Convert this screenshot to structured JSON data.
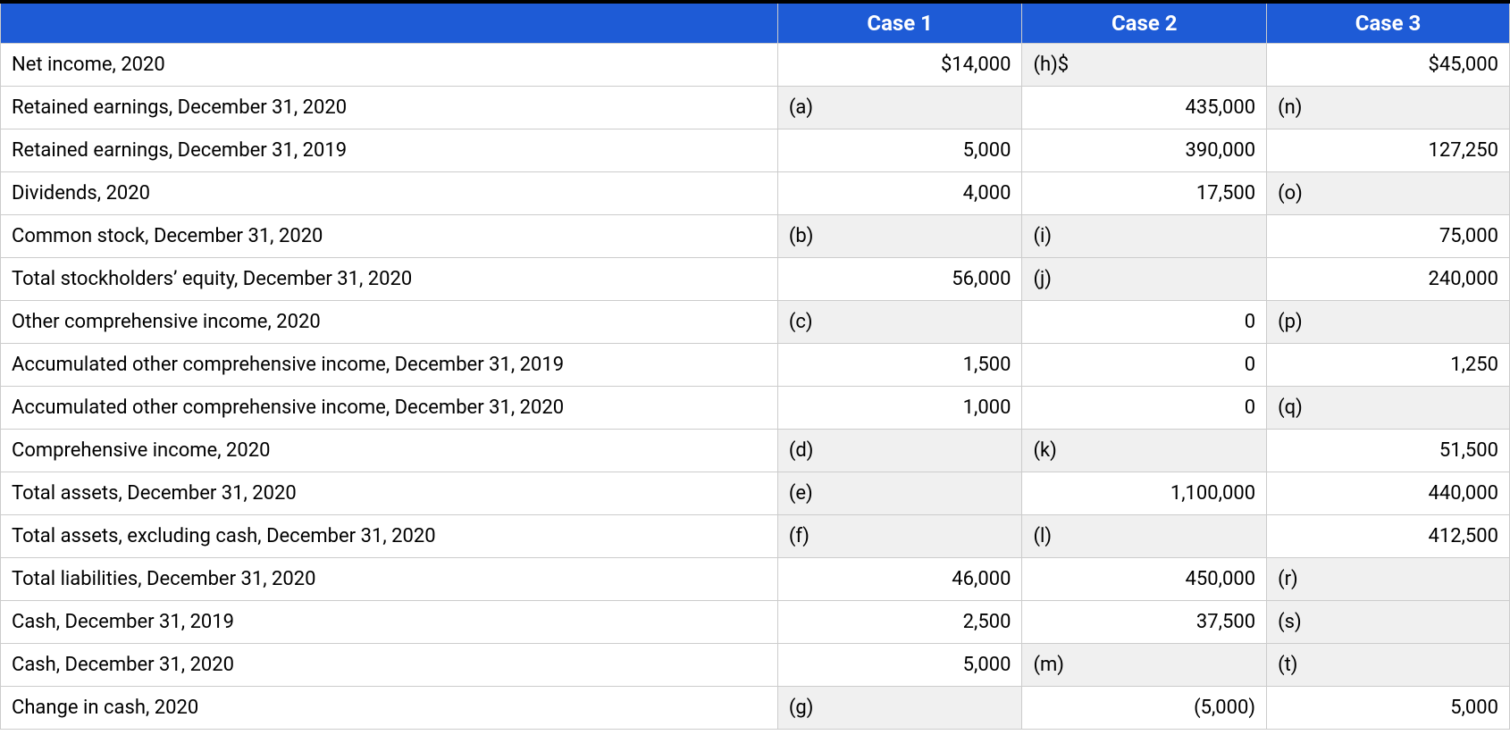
{
  "chart_data": {
    "type": "table",
    "headers": [
      "",
      "Case 1",
      "Case 2",
      "Case 3"
    ],
    "rows": [
      {
        "label": "Net income, 2020",
        "c1": {
          "v": "$14,000",
          "t": "num"
        },
        "c2": {
          "v": "(h)$",
          "t": "letter"
        },
        "c3": {
          "v": "$45,000",
          "t": "num"
        }
      },
      {
        "label": "Retained earnings, December 31, 2020",
        "c1": {
          "v": "(a)",
          "t": "letter"
        },
        "c2": {
          "v": "435,000",
          "t": "num"
        },
        "c3": {
          "v": "(n)",
          "t": "letter"
        }
      },
      {
        "label": "Retained earnings, December 31, 2019",
        "c1": {
          "v": "5,000",
          "t": "num"
        },
        "c2": {
          "v": "390,000",
          "t": "num"
        },
        "c3": {
          "v": "127,250",
          "t": "num"
        }
      },
      {
        "label": "Dividends, 2020",
        "c1": {
          "v": "4,000",
          "t": "num"
        },
        "c2": {
          "v": "17,500",
          "t": "num"
        },
        "c3": {
          "v": "(o)",
          "t": "letter"
        }
      },
      {
        "label": "Common stock, December 31, 2020",
        "c1": {
          "v": "(b)",
          "t": "letter"
        },
        "c2": {
          "v": "(i)",
          "t": "letter"
        },
        "c3": {
          "v": "75,000",
          "t": "num"
        }
      },
      {
        "label": "Total stockholders’ equity, December 31, 2020",
        "c1": {
          "v": "56,000",
          "t": "num"
        },
        "c2": {
          "v": "(j)",
          "t": "letter"
        },
        "c3": {
          "v": "240,000",
          "t": "num"
        }
      },
      {
        "label": "Other comprehensive income, 2020",
        "c1": {
          "v": "(c)",
          "t": "letter"
        },
        "c2": {
          "v": "0",
          "t": "num"
        },
        "c3": {
          "v": "(p)",
          "t": "letter"
        }
      },
      {
        "label": "Accumulated other comprehensive income, December 31, 2019",
        "c1": {
          "v": "1,500",
          "t": "num"
        },
        "c2": {
          "v": "0",
          "t": "num"
        },
        "c3": {
          "v": "1,250",
          "t": "num"
        }
      },
      {
        "label": "Accumulated other comprehensive income, December 31, 2020",
        "c1": {
          "v": "1,000",
          "t": "num"
        },
        "c2": {
          "v": "0",
          "t": "num"
        },
        "c3": {
          "v": "(q)",
          "t": "letter"
        }
      },
      {
        "label": "Comprehensive income, 2020",
        "c1": {
          "v": "(d)",
          "t": "letter"
        },
        "c2": {
          "v": "(k)",
          "t": "letter"
        },
        "c3": {
          "v": "51,500",
          "t": "num"
        }
      },
      {
        "label": "Total assets, December 31, 2020",
        "c1": {
          "v": "(e)",
          "t": "letter"
        },
        "c2": {
          "v": "1,100,000",
          "t": "num"
        },
        "c3": {
          "v": "440,000",
          "t": "num"
        }
      },
      {
        "label": "Total assets, excluding cash, December 31, 2020",
        "c1": {
          "v": "(f)",
          "t": "letter"
        },
        "c2": {
          "v": "(l)",
          "t": "letter"
        },
        "c3": {
          "v": "412,500",
          "t": "num"
        }
      },
      {
        "label": "Total liabilities, December 31, 2020",
        "c1": {
          "v": "46,000",
          "t": "num"
        },
        "c2": {
          "v": "450,000",
          "t": "num"
        },
        "c3": {
          "v": "(r)",
          "t": "letter"
        }
      },
      {
        "label": "Cash, December 31, 2019",
        "c1": {
          "v": "2,500",
          "t": "num"
        },
        "c2": {
          "v": "37,500",
          "t": "num"
        },
        "c3": {
          "v": "(s)",
          "t": "letter"
        }
      },
      {
        "label": "Cash, December 31, 2020",
        "c1": {
          "v": "5,000",
          "t": "num"
        },
        "c2": {
          "v": "(m)",
          "t": "letter"
        },
        "c3": {
          "v": "(t)",
          "t": "letter"
        }
      },
      {
        "label": "Change in cash, 2020",
        "c1": {
          "v": "(g)",
          "t": "letter"
        },
        "c2": {
          "v": "(5,000)",
          "t": "num"
        },
        "c3": {
          "v": "5,000",
          "t": "num"
        }
      }
    ]
  }
}
